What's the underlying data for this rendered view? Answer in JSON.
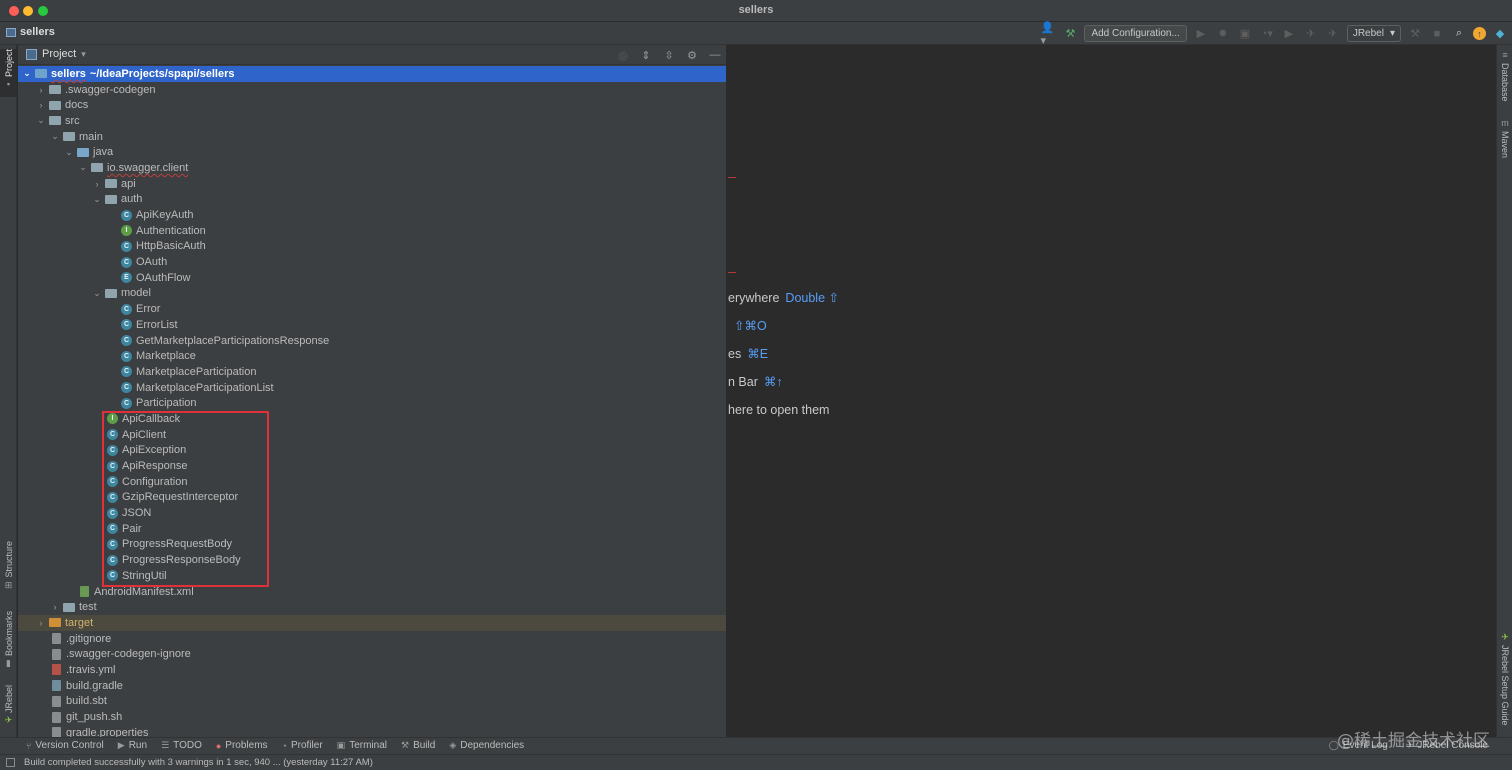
{
  "window": {
    "title": "sellers"
  },
  "navbar": {
    "project_name": "sellers",
    "add_configuration": "Add Configuration...",
    "jrebel_select": "JRebel"
  },
  "left_strip": {
    "project": "Project",
    "structure": "Structure",
    "bookmarks": "Bookmarks",
    "jrebel": "JRebel"
  },
  "right_strip": {
    "database": "Database",
    "maven": "Maven",
    "jrebel_guide": "JRebel Setup Guide"
  },
  "panel": {
    "title": "Project"
  },
  "tree": {
    "root": {
      "name": "sellers",
      "path": "~/IdeaProjects/spapi/sellers"
    },
    "swagger_codegen": ".swagger-codegen",
    "docs": "docs",
    "src": "src",
    "main": "main",
    "java": "java",
    "package": "io.swagger.client",
    "api": "api",
    "auth": "auth",
    "auth_items": [
      "ApiKeyAuth",
      "Authentication",
      "HttpBasicAuth",
      "OAuth",
      "OAuthFlow"
    ],
    "model": "model",
    "model_items": [
      "Error",
      "ErrorList",
      "GetMarketplaceParticipationsResponse",
      "Marketplace",
      "MarketplaceParticipation",
      "MarketplaceParticipationList",
      "Participation"
    ],
    "client_items": [
      "ApiCallback",
      "ApiClient",
      "ApiException",
      "ApiResponse",
      "Configuration",
      "GzipRequestInterceptor",
      "JSON",
      "Pair",
      "ProgressRequestBody",
      "ProgressResponseBody",
      "StringUtil"
    ],
    "manifest": "AndroidManifest.xml",
    "test": "test",
    "target": "target",
    "root_files": [
      ".gitignore",
      ".swagger-codegen-ignore",
      ".travis.yml",
      "build.gradle",
      "build.sbt",
      "git_push.sh",
      "gradle.properties"
    ]
  },
  "editor_hints": [
    {
      "text": "erywhere",
      "shortcut": "Double ⇧"
    },
    {
      "text": "",
      "shortcut": "⇧⌘O"
    },
    {
      "text": "es",
      "shortcut": "⌘E"
    },
    {
      "text": "n Bar",
      "shortcut": "⌘↑"
    },
    {
      "text": "here to open them",
      "shortcut": ""
    }
  ],
  "bottom_bar": {
    "items": [
      "Version Control",
      "Run",
      "TODO",
      "Problems",
      "Profiler",
      "Terminal",
      "Build",
      "Dependencies"
    ],
    "event_log": "Event Log",
    "jrebel_console": "JRebel Console"
  },
  "watermark": "@稀土掘金技术社区",
  "status": {
    "text": "Build completed successfully with 3 warnings in 1 sec, 940 ... (yesterday 11:27 AM)"
  },
  "colors": {
    "selection": "#2f65ca",
    "highlight_box": "#e0303a",
    "shortcut": "#589df6",
    "class_icon": "#3e86a0",
    "interface_icon": "#5e9e46"
  }
}
